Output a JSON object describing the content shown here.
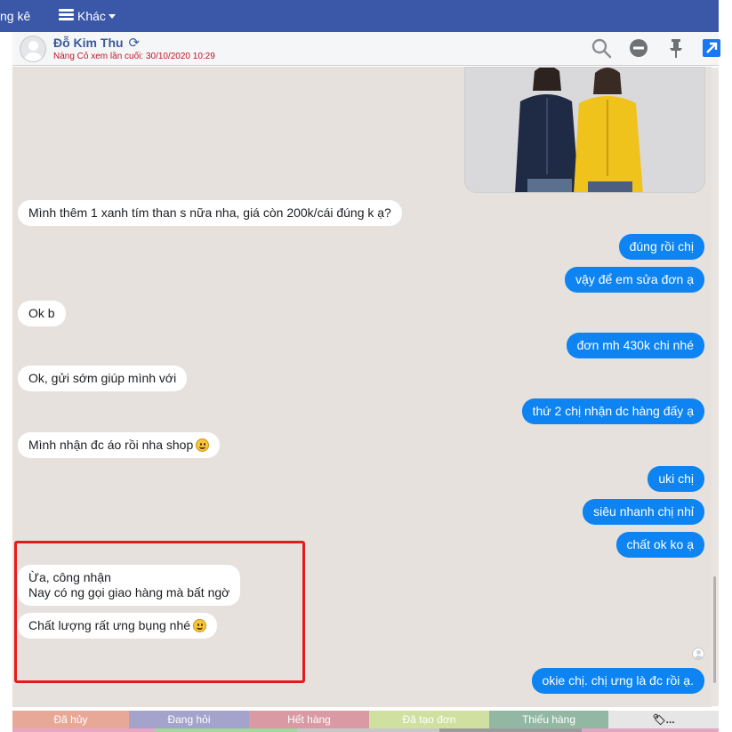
{
  "nav": {
    "stats_label": "ng kê",
    "more_label": "Khác"
  },
  "header": {
    "contact_name": "Đỗ Kim Thu",
    "last_seen": "Nàng Cỏ xem lần cuối: 30/10/2020 10:29"
  },
  "messages": [
    {
      "direction": "incoming",
      "text": "Mình thêm 1 xanh tím than s nữa nha, giá còn 200k/cái đúng k ạ?"
    },
    {
      "direction": "outgoing",
      "text": "đúng rồi chị"
    },
    {
      "direction": "outgoing",
      "text": "vậy để em sửa đơn ạ"
    },
    {
      "direction": "incoming",
      "text": "Ok b"
    },
    {
      "direction": "outgoing",
      "text": "đơn mh 430k chi nhé"
    },
    {
      "direction": "incoming",
      "text": "Ok, gửi sớm giúp mình với"
    },
    {
      "direction": "outgoing",
      "text": "thứ 2 chị nhận dc hàng đấy ạ"
    },
    {
      "direction": "incoming",
      "text": "Mình nhận đc áo rồi nha shop"
    },
    {
      "direction": "outgoing",
      "text": "uki chị"
    },
    {
      "direction": "outgoing",
      "text": "siêu nhanh chị nhỉ"
    },
    {
      "direction": "outgoing",
      "text": "chất ok ko ạ"
    },
    {
      "direction": "incoming",
      "line1": "Ừa, công nhận",
      "line2": "Nay có ng gọi giao hàng mà bất ngờ"
    },
    {
      "direction": "incoming",
      "text": "Chất lượng rất ưng bụng nhé"
    },
    {
      "direction": "outgoing",
      "text": "okie chị. chị ưng là đc rồi ạ."
    }
  ],
  "tags": [
    {
      "label": "Đã hủy",
      "color": "#e8a898"
    },
    {
      "label": "Đang hỏi",
      "color": "#a3a3cc"
    },
    {
      "label": "Hết hàng",
      "color": "#d99aa3"
    },
    {
      "label": "Đã tạo đơn",
      "color": "#cfe0a0"
    },
    {
      "label": "Thiếu hàng",
      "color": "#92b8a3"
    },
    {
      "label": "...",
      "color": "#e6e6e6"
    }
  ],
  "strip_colors": [
    "#e9a7c6",
    "#a7d7a0",
    "#c8c8c8",
    "#9b9b9b",
    "#e0a7c2"
  ],
  "theme": {
    "nav_bg": "#3a57a8",
    "outgoing_bubble": "#0d84f1",
    "incoming_bubble": "#ffffff",
    "chat_bg": "#e6e1dd",
    "highlight_border": "#e31b1b"
  }
}
